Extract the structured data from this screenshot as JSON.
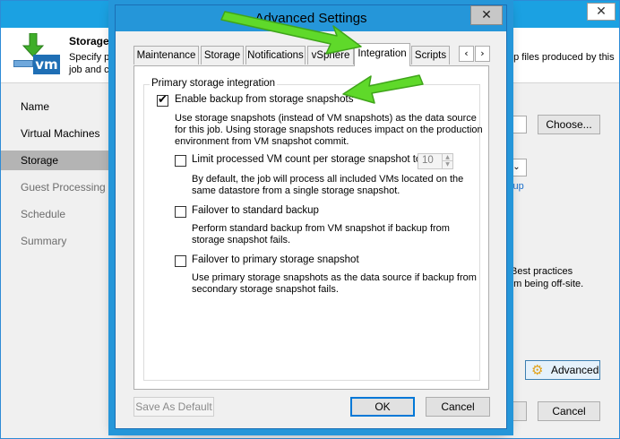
{
  "background": {
    "header": {
      "title": "Storage",
      "desc_line1": "Specify pro",
      "desc_line2": "job and cus",
      "desc_right": "up files produced by this",
      "icon_text": "vm"
    },
    "nav": {
      "items": [
        {
          "label": "Name",
          "state": "normal"
        },
        {
          "label": "Virtual Machines",
          "state": "normal"
        },
        {
          "label": "Storage",
          "state": "selected"
        },
        {
          "label": "Guest Processing",
          "state": "inactive"
        },
        {
          "label": "Schedule",
          "state": "inactive"
        },
        {
          "label": "Summary",
          "state": "inactive"
        }
      ]
    },
    "choose_button": "Choose...",
    "link_partial": "kup",
    "best_practices_line1": "Best practices",
    "best_practices_line2": "em being off-site.",
    "advanced_button": "Advanced",
    "cancel_button": "Cancel"
  },
  "dialog": {
    "title": "Advanced Settings",
    "tabs": [
      {
        "label": "Maintenance",
        "active": false
      },
      {
        "label": "Storage",
        "active": false
      },
      {
        "label": "Notifications",
        "active": false
      },
      {
        "label": "vSphere",
        "active": false
      },
      {
        "label": "Integration",
        "active": true
      },
      {
        "label": "Scripts",
        "active": false
      }
    ],
    "group_label": "Primary storage integration",
    "options": {
      "enable_backup": {
        "label": "Enable backup from storage snapshots",
        "checked": true,
        "desc_lines": [
          "Use storage snapshots (instead of VM snapshots) as the data source",
          "for this job. Using storage snapshots reduces impact on the production",
          "environment from VM snapshot commit."
        ]
      },
      "limit_vm_count": {
        "label": "Limit processed VM count per storage snapshot to",
        "checked": false,
        "value": "10",
        "desc_lines": [
          "By default, the job will process all included VMs located on the",
          "same datastore from a single storage snapshot."
        ]
      },
      "failover_standard": {
        "label": "Failover to standard backup",
        "checked": false,
        "desc_lines": [
          "Perform standard backup from VM snapshot if backup from",
          "storage snapshot fails."
        ]
      },
      "failover_primary": {
        "label": "Failover to primary storage snapshot",
        "checked": false,
        "desc_lines": [
          "Use primary storage snapshots as the data source if backup from",
          "secondary storage snapshot fails."
        ]
      }
    },
    "buttons": {
      "save_as_default": "Save As Default",
      "ok": "OK",
      "cancel": "Cancel"
    }
  },
  "colors": {
    "titlebar": "#2596d9",
    "selected_nav": "#b4b4b4",
    "annotation_arrow": "#5fd92a",
    "link": "#1a6fcc"
  }
}
